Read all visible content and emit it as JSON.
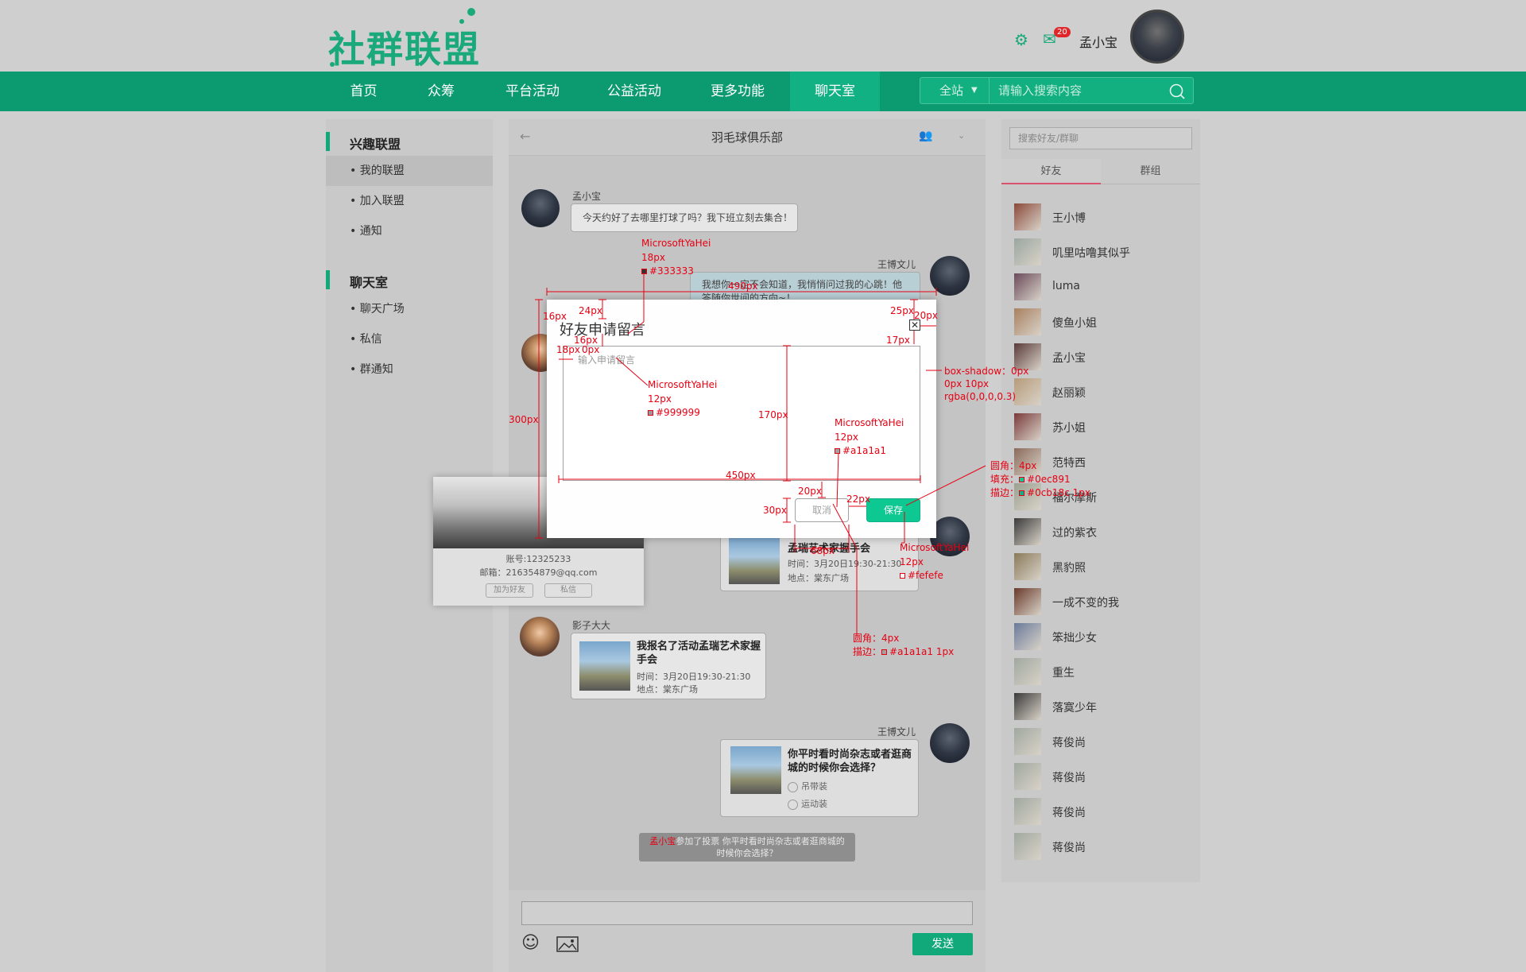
{
  "header": {
    "logo_text": "社群联盟",
    "mail_count": "20",
    "username": "孟小宝"
  },
  "nav": {
    "items": [
      "首页",
      "众筹",
      "平台活动",
      "公益活动",
      "更多功能",
      "聊天室"
    ],
    "active_index": 5
  },
  "search": {
    "scope": "全站",
    "placeholder": "请输入搜索内容"
  },
  "sidebar": {
    "section1": "兴趣联盟",
    "section1_items": [
      "我的联盟",
      "加入联盟",
      "通知"
    ],
    "section2": "聊天室",
    "section2_items": [
      "聊天广场",
      "私信",
      "群通知"
    ]
  },
  "chat": {
    "title": "羽毛球俱乐部",
    "msg1_user": "孟小宝",
    "msg1_text": "今天约好了去哪里打球了吗？我下班立刻去集合！",
    "msg2_user": "王博文儿",
    "msg2_text": "我想你一定不会知道，我悄悄问过我的心跳！他",
    "msg2_text2": "答随你世间的方向~！",
    "event_card_title": "孟瑞艺术家握手会",
    "event_card_time": "时间：3月20日19:30-21:30",
    "event_card_place": "地点：棠东广场",
    "msg3_user": "影子大大",
    "msg3_title": "我报名了活动孟瑞艺术家握手会",
    "msg3_time": "时间：3月20日19:30-21:30",
    "msg3_place": "地点：棠东广场",
    "msg4_user": "王博文儿",
    "msg4_title": "你平时看时尚杂志或者逛商城的时候你会选择？",
    "msg4_opt1": "吊带装",
    "msg4_opt2": "运动装",
    "notice_user": "孟小宝",
    "notice_text": "参加了投票 你平时看时尚杂志或者逛商城的时候你会选择？",
    "send_label": "发送"
  },
  "profile_card": {
    "account": "账号:12325233",
    "email": "邮箱：216354879@qq.com",
    "add_friend": "加为好友",
    "message": "私信"
  },
  "right": {
    "search_placeholder": "搜索好友/群聊",
    "tab_friends": "好友",
    "tab_groups": "群组",
    "friends": [
      "王小博",
      "叽里咕噜其似乎",
      "luma",
      "傻鱼小姐",
      "孟小宝",
      "赵丽颖",
      "苏小姐",
      "范特西",
      "福尔摩斯",
      "过的紫衣",
      "黑豹照",
      "一成不变的我",
      "笨拙少女",
      "重生",
      "落寞少年",
      "蒋俊尚",
      "蒋俊尚",
      "蒋俊尚",
      "蒋俊尚"
    ]
  },
  "dialog": {
    "title": "好友申请留言",
    "placeholder": "输入申请留言",
    "cancel": "取消",
    "save": "保存"
  },
  "annotations": {
    "a_font1": "MicrosoftYaHei",
    "a_size18": "18px",
    "a_color333": "#333333",
    "a_490": "490px",
    "a_24": "24px",
    "a_16a": "16px",
    "a_25": "25px",
    "a_20": "20px",
    "a_17": "17px",
    "a_16b": "16px",
    "a_18": "18px",
    "a_0": "0px",
    "a_font2": "MicrosoftYaHei",
    "a_12a": "12px",
    "a_color999": "#999999",
    "a_300": "300px",
    "a_170": "170px",
    "a_font3": "MicrosoftYaHei",
    "a_12b": "12px",
    "a_colora1": "#a1a1a1",
    "a_450": "450px",
    "a_20b": "20px",
    "a_22": "22px",
    "a_30": "30px",
    "a_68": "68px",
    "a_shadow1": "box-shadow：0px",
    "a_shadow2": "0px 10px",
    "a_shadow3": "rgba(0,0,0,0.3)",
    "a_r1": "圆角：4px",
    "a_fill": "填充：",
    "a_fill_c": "#0ec891",
    "a_stroke": "描边：",
    "a_stroke_c": "#0cb18c 1px",
    "a_font4": "MicrosoftYaHei",
    "a_12c": "12px",
    "a_colorfe": "#fefefe",
    "a_r2": "圆角：4px",
    "a_stroke2": "描边：",
    "a_stroke2_c": "#a1a1a1 1px"
  },
  "colors": {
    "brand": "#0c9a70",
    "accent": "#0ec891",
    "annotation": "#e60012"
  }
}
